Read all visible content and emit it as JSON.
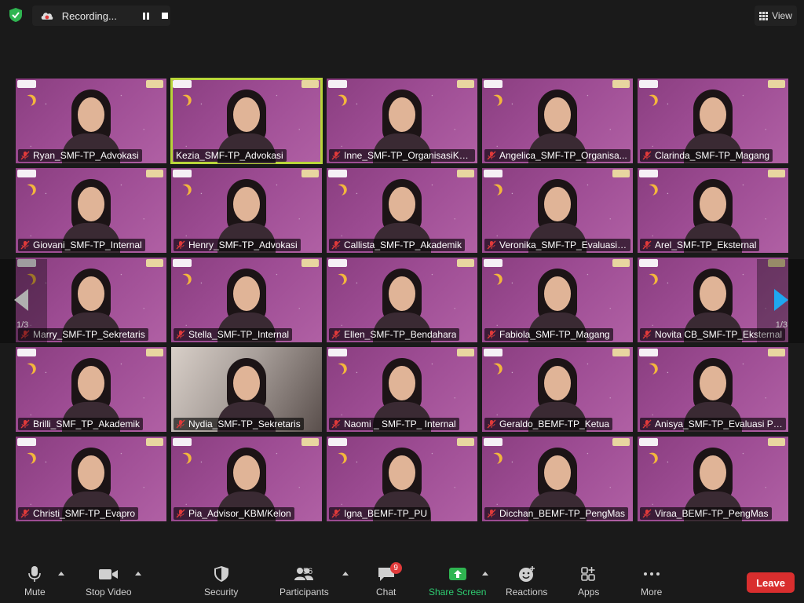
{
  "topbar": {
    "recording_label": "Recording...",
    "view_label": "View"
  },
  "gallery": {
    "page_left": "1/3",
    "page_right": "1/3",
    "participants": [
      {
        "name": "Ryan_SMF-TP_Advokasi",
        "muted": true
      },
      {
        "name": "Kezia_SMF-TP_Advokasi",
        "muted": false,
        "active": true
      },
      {
        "name": "Inne_SMF-TP_OrganisasiKa...",
        "muted": true
      },
      {
        "name": "Angelica_SMF-TP_Organisa...",
        "muted": true
      },
      {
        "name": "Clarinda_SMF-TP_Magang",
        "muted": true
      },
      {
        "name": "Giovani_SMF-TP_Internal",
        "muted": true
      },
      {
        "name": "Henry_SMF-TP_Advokasi",
        "muted": true
      },
      {
        "name": "Callista_SMF-TP_Akademik",
        "muted": true
      },
      {
        "name": "Veronika_SMF-TP_Evaluasi ...",
        "muted": true
      },
      {
        "name": "Arel_SMF-TP_Eksternal",
        "muted": true
      },
      {
        "name": "Marry_SMF-TP_Sekretaris",
        "muted": true
      },
      {
        "name": "Stella_SMF-TP_Internal",
        "muted": true
      },
      {
        "name": "Ellen_SMF-TP_Bendahara",
        "muted": true
      },
      {
        "name": "Fabiola_SMF-TP_Magang",
        "muted": true
      },
      {
        "name": "Novita CB_SMF-TP_Eksternal",
        "muted": true
      },
      {
        "name": "Brilli_SMF_TP_Akademik",
        "muted": true
      },
      {
        "name": "Nydia_SMF-TP_Sekretaris",
        "muted": true,
        "background": "car"
      },
      {
        "name": "Naomi _ SMF-TP_ Internal",
        "muted": true
      },
      {
        "name": "Geraldo_BEMF-TP_Ketua",
        "muted": true
      },
      {
        "name": "Anisya_SMF-TP_Evaluasi Pr...",
        "muted": true
      },
      {
        "name": "Christi_SMF-TP_Evapro",
        "muted": true
      },
      {
        "name": "Pia_Advisor_KBM/Kelon",
        "muted": true
      },
      {
        "name": "Igna_BEMF-TP_PU",
        "muted": true
      },
      {
        "name": "Dicchan_BEMF-TP_PengMas",
        "muted": true
      },
      {
        "name": "Viraa_BEMF-TP_PengMas",
        "muted": true
      }
    ]
  },
  "toolbar": {
    "mute_label": "Mute",
    "stop_video_label": "Stop Video",
    "security_label": "Security",
    "participants_label": "Participants",
    "participants_count": "56",
    "chat_label": "Chat",
    "chat_badge": "9",
    "share_screen_label": "Share Screen",
    "reactions_label": "Reactions",
    "apps_label": "Apps",
    "more_label": "More",
    "leave_label": "Leave"
  },
  "colors": {
    "background": "#1a1a1a",
    "tile_purple": "#9d4c93",
    "active_speaker": "#b9d53a",
    "muted_red": "#e03a3a",
    "share_green": "#2ecc71",
    "leave_red": "#d92e2e",
    "nav_arrow_blue": "#1ea7f0"
  }
}
